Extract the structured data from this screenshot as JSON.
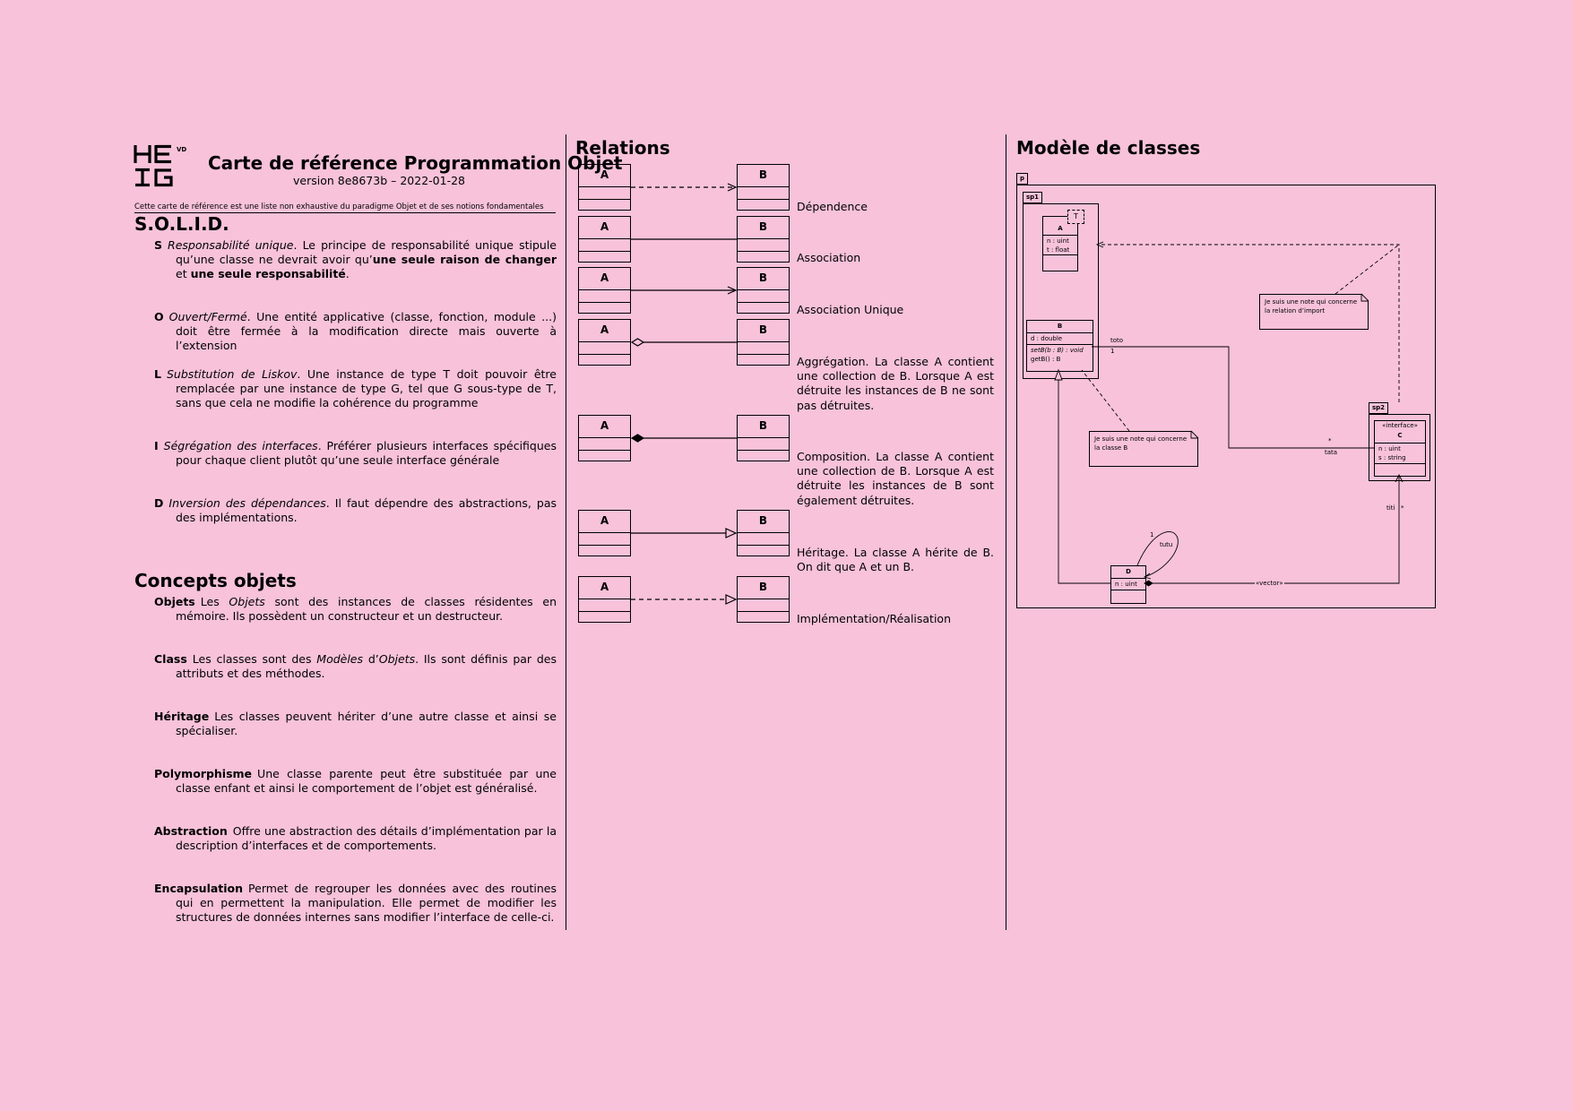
{
  "header": {
    "logo_text": "HEIG-VD",
    "title": "Carte de référence Programmation Objet",
    "version": "version 8e8673b – 2022-01-28",
    "subtitle": "Cette carte de référence est une liste non exhaustive du paradigme Objet et de ses notions fondamentales"
  },
  "solid": {
    "heading": "S.O.L.I.D.",
    "items": [
      {
        "key": "S",
        "term": "Responsabilité unique",
        "text1": ". Le principe de responsabilité unique stipule qu’une classe ne devrait avoir qu’",
        "bold1": "une seule raison de changer",
        "text2": " et ",
        "bold2": "une seule responsabilité",
        "text3": "."
      },
      {
        "key": "O",
        "term": "Ouvert/Fermé",
        "text": ". Une entité applicative (classe, fonction, module ...) doit être fermée à la modification directe mais ouverte à l’extension"
      },
      {
        "key": "L",
        "term": "Substitution de Liskov",
        "text": ". Une instance de type T doit pouvoir être remplacée par une instance de type G, tel que G sous-type de T, sans que cela ne modifie la cohérence du programme"
      },
      {
        "key": "I",
        "term": "Ségrégation des interfaces",
        "text": ". Préférer plusieurs interfaces spécifiques pour chaque client plutôt qu’une seule interface générale"
      },
      {
        "key": "D",
        "term": "Inversion des dépendances",
        "text": ". Il faut dépendre des abstractions, pas des implémentations."
      }
    ]
  },
  "concepts": {
    "heading": "Concepts objets",
    "items": [
      {
        "key": "Objets",
        "t1": "Les ",
        "i1": "Objets",
        "t2": " sont des instances de classes résidentes en mémoire. Ils possèdent un constructeur et un destructeur.",
        "i2": "",
        "t3": ""
      },
      {
        "key": "Class",
        "t1": "Les classes sont des ",
        "i1": "Modèles",
        "t2": " d’",
        "i2": "Objets",
        "t3": ". Ils sont définis par des attributs et des méthodes."
      },
      {
        "key": "Héritage",
        "t1": "Les classes peuvent hériter d’une autre classe et ainsi se spécialiser.",
        "i1": "",
        "t2": "",
        "i2": "",
        "t3": ""
      },
      {
        "key": "Polymorphisme",
        "t1": "Une classe parente peut être substituée par une classe enfant et ainsi le comportement de l’objet est généralisé.",
        "i1": "",
        "t2": "",
        "i2": "",
        "t3": ""
      },
      {
        "key": "Abstraction",
        "t1": "Offre une abstraction des détails d’implémentation par la description d’interfaces et de comportements.",
        "i1": "",
        "t2": "",
        "i2": "",
        "t3": ""
      },
      {
        "key": "Encapsulation",
        "t1": "Permet de regrouper les données avec des routines qui en permettent la manipulation. Elle permet de modifier les structures de données internes sans modifier l’interface de celle-ci.",
        "i1": "",
        "t2": "",
        "i2": "",
        "t3": ""
      }
    ]
  },
  "relations": {
    "heading": "Relations",
    "class_a": "A",
    "class_b": "B",
    "items": [
      {
        "kind": "dependence",
        "label": "Dépendence"
      },
      {
        "kind": "association",
        "label": "Association"
      },
      {
        "kind": "unique-association",
        "label": "Association Unique"
      },
      {
        "kind": "aggregation",
        "label": "Aggrégation. La classe A contient une collection de B. Lorsque A est détruite les instances de B ne sont pas détruites."
      },
      {
        "kind": "composition",
        "label": "Composition. La classe A contient une collection de B. Lorsque A est détruite les instances de B sont également détruites."
      },
      {
        "kind": "inheritance",
        "label": "Héritage. La classe A hérite de B. On dit que A et un B."
      },
      {
        "kind": "realization",
        "label": "Implémentation/Réalisation"
      }
    ]
  },
  "model": {
    "heading": "Modèle de classes",
    "pkg_p": "p",
    "pkg_sp1": "sp1",
    "pkg_sp2": "sp2",
    "class_a": {
      "name": "A",
      "template": "T",
      "attrs": [
        "n : uint",
        "t : float"
      ]
    },
    "class_b": {
      "name": "B",
      "attrs": [
        "d : double"
      ],
      "ops": [
        "setB(b : B) : void",
        "getB() : B"
      ]
    },
    "class_c": {
      "stereotype": "«interface»",
      "name": "C",
      "attrs": [
        "n : uint",
        "s : string"
      ]
    },
    "class_d": {
      "name": "D",
      "attrs": [
        "n : uint"
      ]
    },
    "note_import": "Je suis une note qui concerne la relation d’import",
    "note_b": "Je suis une note qui concerne la classe B",
    "labels": {
      "toto": "toto",
      "one_b": "1",
      "star_c": "*",
      "tata": "tata",
      "titi": "titi",
      "star_titi": "*",
      "one_d": "1",
      "tutu": "tutu",
      "vector": "«vector»"
    }
  }
}
